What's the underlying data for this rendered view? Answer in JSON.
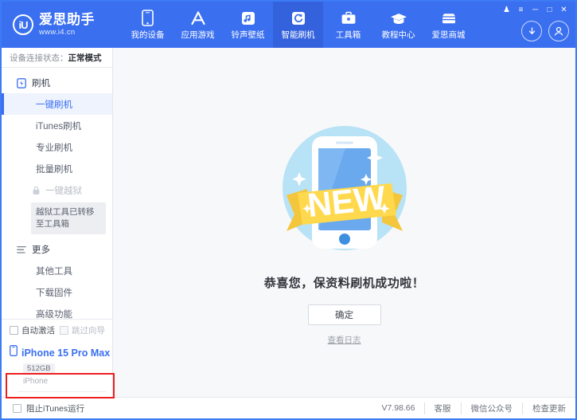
{
  "window": {
    "controls": [
      {
        "name": "skin-icon",
        "glyph": "♟"
      },
      {
        "name": "menu-icon",
        "glyph": "≡"
      },
      {
        "name": "minimize-icon",
        "glyph": "─"
      },
      {
        "name": "maximize-icon",
        "glyph": "□"
      },
      {
        "name": "close-icon",
        "glyph": "✕"
      }
    ]
  },
  "header": {
    "logo": {
      "mark": "iU",
      "title": "爱思助手",
      "sub": "www.i4.cn"
    },
    "nav": [
      {
        "label": "我的设备",
        "icon": "phone-icon",
        "active": false
      },
      {
        "label": "应用游戏",
        "icon": "appstore-icon",
        "active": false
      },
      {
        "label": "铃声壁纸",
        "icon": "music-icon",
        "active": false
      },
      {
        "label": "智能刷机",
        "icon": "refresh-icon",
        "active": true
      },
      {
        "label": "工具箱",
        "icon": "toolbox-icon",
        "active": false
      },
      {
        "label": "教程中心",
        "icon": "graduation-icon",
        "active": false
      },
      {
        "label": "爱思商城",
        "icon": "shop-icon",
        "active": false
      }
    ],
    "download_icon": "download-icon",
    "account_icon": "account-icon",
    "accent": "#3a6ff0",
    "accent_active": "#3462dd"
  },
  "sidebar": {
    "connection": {
      "label": "设备连接状态：",
      "value": "正常模式"
    },
    "sections": [
      {
        "title": "刷机",
        "icon": "flash-phone-icon",
        "items": [
          {
            "label": "一键刷机",
            "selected": true,
            "disabled": false
          },
          {
            "label": "iTunes刷机",
            "selected": false,
            "disabled": false
          },
          {
            "label": "专业刷机",
            "selected": false,
            "disabled": false
          },
          {
            "label": "批量刷机",
            "selected": false,
            "disabled": false
          }
        ]
      }
    ],
    "jailbreak": {
      "label": "一键越狱",
      "icon": "lock-icon",
      "disabled": true
    },
    "jailbreak_tip": "越狱工具已转移至工具箱",
    "more": {
      "title": "更多",
      "icon": "list-icon",
      "items": [
        {
          "label": "其他工具"
        },
        {
          "label": "下载固件"
        },
        {
          "label": "高级功能"
        }
      ]
    },
    "options": [
      {
        "label": "自动激活",
        "checked": false,
        "disabled": false
      },
      {
        "label": "跳过向导",
        "checked": false,
        "disabled": true
      }
    ],
    "highlight_color": "#ef1f1f",
    "device": {
      "icon": "device-phone-icon",
      "name": "iPhone 15 Pro Max",
      "capacity": "512GB",
      "type": "iPhone"
    }
  },
  "main": {
    "illustration": {
      "name": "new-phone-badge-illustration",
      "ribbon_text": "NEW",
      "circle_color": "#b8e2f5",
      "ribbon_color": "#ffd94d",
      "phone_screen_color": "#6aa9ee"
    },
    "message": "恭喜您，保资料刷机成功啦！",
    "confirm_label": "确定",
    "log_link": "查看日志"
  },
  "footer": {
    "block_itunes": {
      "label": "阻止iTunes运行",
      "checked": false
    },
    "version": "V7.98.66",
    "links": [
      {
        "label": "客服"
      },
      {
        "label": "微信公众号"
      },
      {
        "label": "检查更新"
      }
    ]
  }
}
